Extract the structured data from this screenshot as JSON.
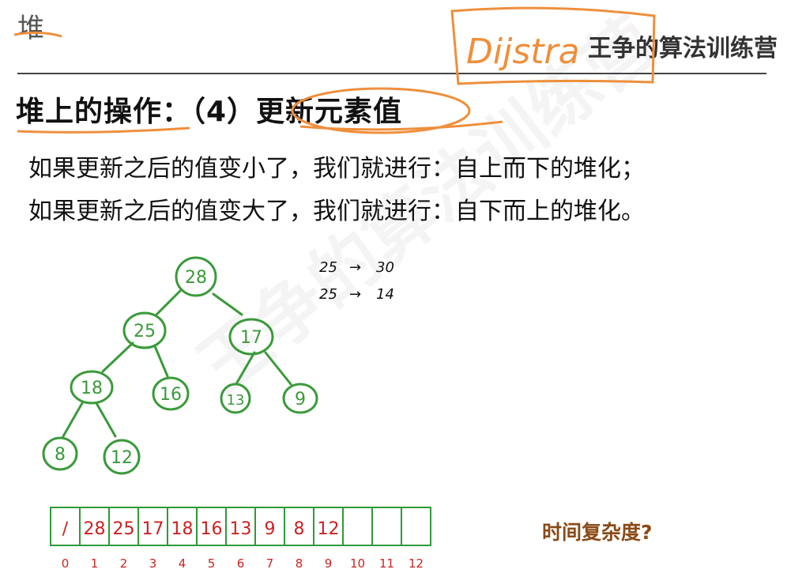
{
  "section_title": "堆",
  "brand": "王争的算法训练营",
  "heading": "堆上的操作：（4）更新元素值",
  "rules": [
    "如果更新之后的值变小了，我们就进行：自上而下的堆化；",
    "如果更新之后的值变大了，我们就进行：自下而上的堆化。"
  ],
  "question": "时间复杂度?",
  "annotation_handwritten": "Dijstra",
  "notes": [
    {
      "from": "25",
      "to": "30"
    },
    {
      "from": "25",
      "to": "14"
    }
  ],
  "tree": {
    "nodes": [
      "28",
      "25",
      "17",
      "18",
      "16",
      "13",
      "9",
      "8",
      "12"
    ]
  },
  "array": {
    "cells": [
      "/",
      "28",
      "25",
      "17",
      "18",
      "16",
      "13",
      "9",
      "8",
      "12",
      "",
      "",
      ""
    ],
    "indices": [
      "0",
      "1",
      "2",
      "3",
      "4",
      "5",
      "6",
      "7",
      "8",
      "9",
      "10",
      "11",
      "12"
    ]
  },
  "colors": {
    "tree": "#3a9a3a",
    "array_border": "#2f9a3a",
    "array_text": "#cc2222",
    "highlight": "#ee8f3c",
    "question": "#8a4a17"
  }
}
